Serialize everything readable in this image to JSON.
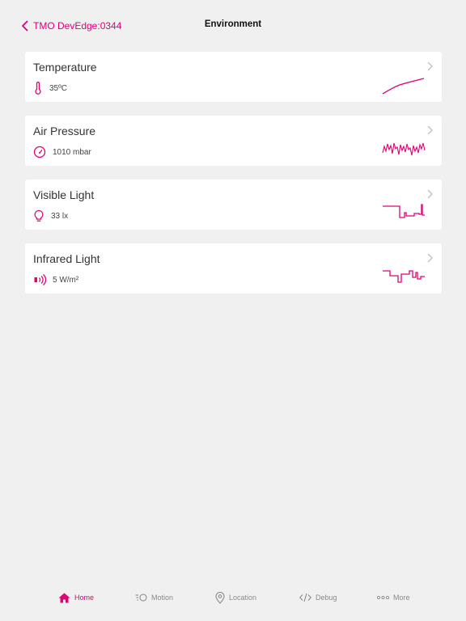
{
  "colors": {
    "accent": "#e20074",
    "background": "#f0f0f0",
    "card": "#ffffff",
    "inactive": "#8a8a8a"
  },
  "nav": {
    "back_label": "TMO DevEdge:0344",
    "title": "Environment"
  },
  "cards": [
    {
      "title": "Temperature",
      "value": "35ºC",
      "icon": "thermometer-icon"
    },
    {
      "title": "Air Pressure",
      "value": "1010 mbar",
      "icon": "gauge-icon"
    },
    {
      "title": "Visible Light",
      "value": "33 lx",
      "icon": "lightbulb-icon"
    },
    {
      "title": "Infrared Light",
      "value": "5 W/m²",
      "icon": "infrared-icon"
    }
  ],
  "tabs": [
    {
      "label": "Home",
      "icon": "home-icon",
      "active": true
    },
    {
      "label": "Motion",
      "icon": "motion-icon",
      "active": false
    },
    {
      "label": "Location",
      "icon": "location-pin-icon",
      "active": false
    },
    {
      "label": "Debug",
      "icon": "code-icon",
      "active": false
    },
    {
      "label": "More",
      "icon": "more-dots-icon",
      "active": false
    }
  ]
}
